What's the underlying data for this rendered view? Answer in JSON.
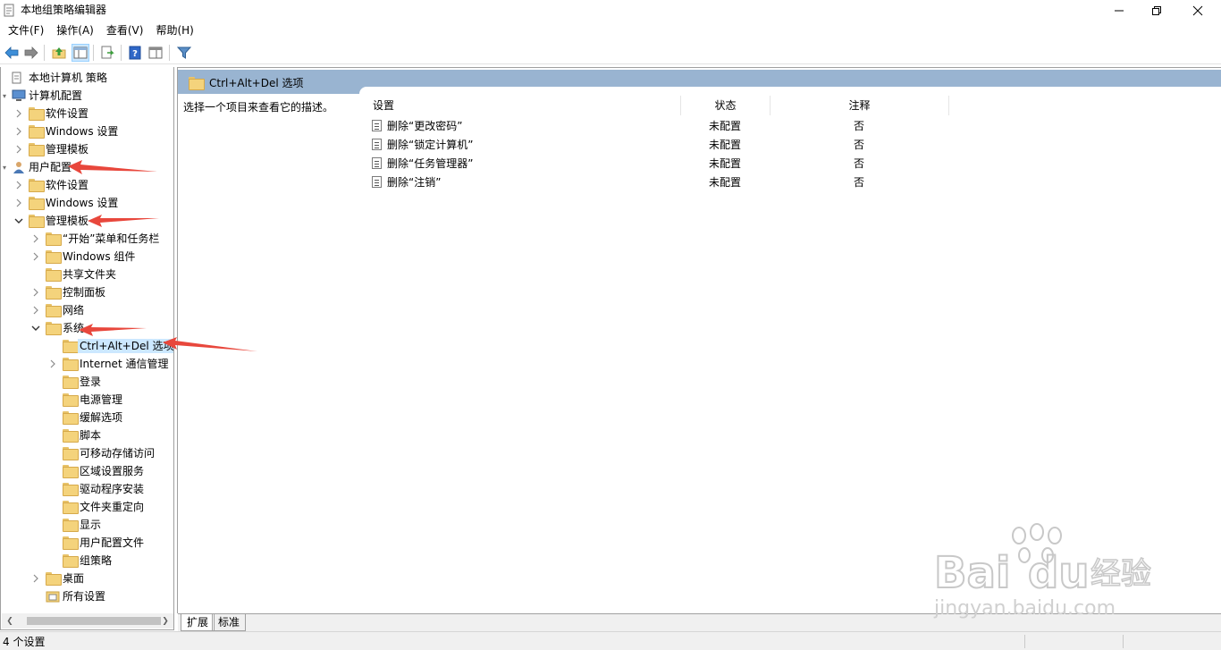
{
  "window": {
    "title": "本地组策略编辑器"
  },
  "menu": [
    {
      "label": "文件(F)"
    },
    {
      "label": "操作(A)"
    },
    {
      "label": "查看(V)"
    },
    {
      "label": "帮助(H)"
    }
  ],
  "toolbar": {
    "buttons": [
      "back-icon",
      "forward-icon",
      "up-folder-icon",
      "show-hide-tree-icon",
      "export-list-icon",
      "help-icon",
      "properties-view-icon",
      "filter-icon"
    ]
  },
  "tree": [
    {
      "label": "本地计算机 策略",
      "level": 0,
      "expander": "none",
      "icon": "policy-doc-icon"
    },
    {
      "label": "计算机配置",
      "level": 0,
      "expander": "expanded-small",
      "icon": "computer-icon"
    },
    {
      "label": "软件设置",
      "level": 1,
      "expander": "collapsed",
      "icon": "folder-icon"
    },
    {
      "label": "Windows 设置",
      "level": 1,
      "expander": "collapsed",
      "icon": "folder-icon"
    },
    {
      "label": "管理模板",
      "level": 1,
      "expander": "collapsed",
      "icon": "folder-icon"
    },
    {
      "label": "用户配置",
      "level": 0,
      "expander": "expanded-small",
      "icon": "user-icon"
    },
    {
      "label": "软件设置",
      "level": 1,
      "expander": "collapsed",
      "icon": "folder-icon"
    },
    {
      "label": "Windows 设置",
      "level": 1,
      "expander": "collapsed",
      "icon": "folder-icon"
    },
    {
      "label": "管理模板",
      "level": 1,
      "expander": "expanded",
      "icon": "folder-icon"
    },
    {
      "label": "“开始”菜单和任务栏",
      "level": 2,
      "expander": "collapsed",
      "icon": "folder-icon"
    },
    {
      "label": "Windows 组件",
      "level": 2,
      "expander": "collapsed",
      "icon": "folder-icon"
    },
    {
      "label": "共享文件夹",
      "level": 2,
      "expander": "none",
      "icon": "folder-icon"
    },
    {
      "label": "控制面板",
      "level": 2,
      "expander": "collapsed",
      "icon": "folder-icon"
    },
    {
      "label": "网络",
      "level": 2,
      "expander": "collapsed",
      "icon": "folder-icon"
    },
    {
      "label": "系统",
      "level": 2,
      "expander": "expanded",
      "icon": "folder-icon"
    },
    {
      "label": "Ctrl+Alt+Del 选项",
      "level": 3,
      "expander": "none",
      "icon": "folder-open-icon",
      "selected": true
    },
    {
      "label": "Internet 通信管理",
      "level": 3,
      "expander": "collapsed",
      "icon": "folder-icon"
    },
    {
      "label": "登录",
      "level": 3,
      "expander": "none",
      "icon": "folder-icon"
    },
    {
      "label": "电源管理",
      "level": 3,
      "expander": "none",
      "icon": "folder-icon"
    },
    {
      "label": "缓解选项",
      "level": 3,
      "expander": "none",
      "icon": "folder-icon"
    },
    {
      "label": "脚本",
      "level": 3,
      "expander": "none",
      "icon": "folder-icon"
    },
    {
      "label": "可移动存储访问",
      "level": 3,
      "expander": "none",
      "icon": "folder-icon"
    },
    {
      "label": "区域设置服务",
      "level": 3,
      "expander": "none",
      "icon": "folder-icon"
    },
    {
      "label": "驱动程序安装",
      "level": 3,
      "expander": "none",
      "icon": "folder-icon"
    },
    {
      "label": "文件夹重定向",
      "level": 3,
      "expander": "none",
      "icon": "folder-icon"
    },
    {
      "label": "显示",
      "level": 3,
      "expander": "none",
      "icon": "folder-icon"
    },
    {
      "label": "用户配置文件",
      "level": 3,
      "expander": "none",
      "icon": "folder-icon"
    },
    {
      "label": "组策略",
      "level": 3,
      "expander": "none",
      "icon": "folder-icon"
    },
    {
      "label": "桌面",
      "level": 2,
      "expander": "collapsed",
      "icon": "folder-icon"
    },
    {
      "label": "所有设置",
      "level": 2,
      "expander": "none",
      "icon": "all-settings-icon"
    }
  ],
  "details": {
    "title": "Ctrl+Alt+Del 选项",
    "description": "选择一个项目来查看它的描述。",
    "columns": {
      "setting": "设置",
      "state": "状态",
      "comment": "注释"
    },
    "rows": [
      {
        "setting": "删除“更改密码”",
        "state": "未配置",
        "comment": "否"
      },
      {
        "setting": "删除“锁定计算机”",
        "state": "未配置",
        "comment": "否"
      },
      {
        "setting": "删除“任务管理器”",
        "state": "未配置",
        "comment": "否"
      },
      {
        "setting": "删除“注销”",
        "state": "未配置",
        "comment": "否"
      }
    ]
  },
  "tabs": [
    {
      "label": "扩展",
      "active": true
    },
    {
      "label": "标准",
      "active": false
    }
  ],
  "status": {
    "text": "4 个设置"
  },
  "colors": {
    "header_band": "#99b4d1",
    "selection": "#cce8ff",
    "annotation_arrow": "#e8473c"
  }
}
